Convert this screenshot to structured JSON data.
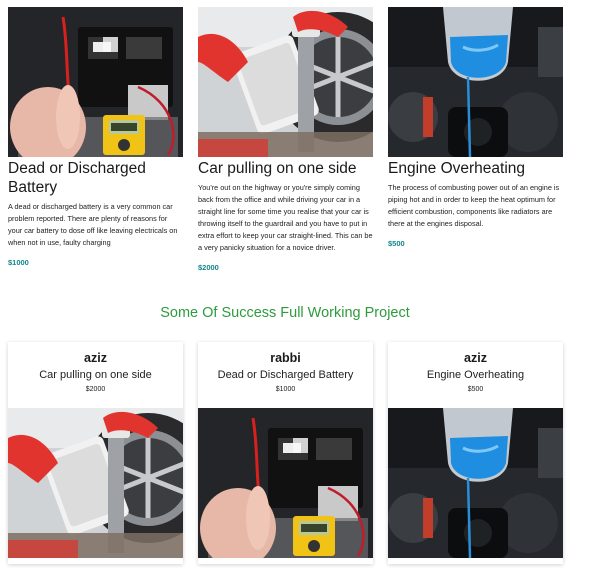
{
  "services": [
    {
      "title": "Dead or Discharged Battery",
      "description": "A dead or discharged battery is a very common car problem reported. There are plenty of reasons for your car battery to dose off like leaving electricals on when not in use, faulty charging",
      "price": "$1000",
      "image_icon": "battery-multimeter-photo"
    },
    {
      "title": "Car pulling on one side",
      "description": "You're out on the highway or you're simply coming back from the office and while driving your car in a straight line for some time you realise that your car is throwing itself to the guardrail and you have to put in extra effort to keep your car straight-lined. This can be a very panicky situation for a novice driver.",
      "price": "$2000",
      "image_icon": "wheel-alignment-photo"
    },
    {
      "title": "Engine Overheating",
      "description": "The process of combusting power out of an engine is piping hot and in order to keep the heat optimum for efficient combustion, components like radiators are there at the engines disposal.",
      "price": "$500",
      "image_icon": "coolant-pour-photo"
    }
  ],
  "section_title": "Some Of Success Full Working Project",
  "projects": [
    {
      "name": "aziz",
      "title": "Car pulling on one side",
      "price": "$2000",
      "image_icon": "wheel-alignment-photo"
    },
    {
      "name": "rabbi",
      "title": "Dead or Discharged Battery",
      "price": "$1000",
      "image_icon": "battery-multimeter-photo"
    },
    {
      "name": "aziz",
      "title": "Engine Overheating",
      "price": "$500",
      "image_icon": "coolant-pour-photo"
    }
  ],
  "colors": {
    "price_accent": "#11878f",
    "section_title": "#2e9b3d"
  }
}
